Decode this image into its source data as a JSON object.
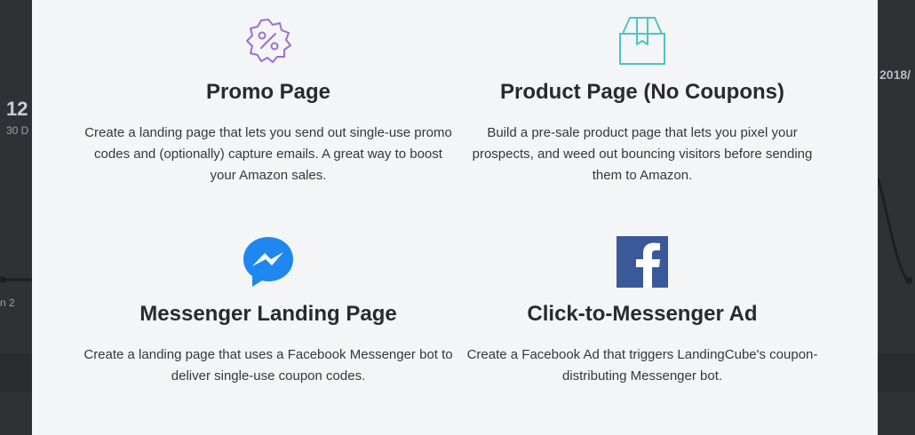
{
  "background": {
    "stat_value": "12",
    "stat_caption": "30 D",
    "axis_label": "n 2",
    "date_label": "2018/"
  },
  "cards": [
    {
      "title": "Promo Page",
      "description": "Create a landing page that lets you send out single-use promo codes and (optionally) capture emails. A great way to boost your Amazon sales.",
      "icon": "percent-badge-icon",
      "icon_color": "#9b6fd6"
    },
    {
      "title": "Product Page (No Coupons)",
      "description": "Build a pre-sale product page that lets you pixel your prospects, and weed out bouncing visitors before sending them to Amazon.",
      "icon": "box-icon",
      "icon_color": "#4fc3c7"
    },
    {
      "title": "Messenger Landing Page",
      "description": "Create a landing page that uses a Facebook Messenger bot to deliver single-use coupon codes.",
      "icon": "messenger-icon",
      "icon_color": "#1e88f0"
    },
    {
      "title": "Click-to-Messenger Ad",
      "description": "Create a Facebook Ad that triggers LandingCube's coupon-distributing Messenger bot.",
      "icon": "facebook-icon",
      "icon_color": "#3b5998"
    }
  ]
}
